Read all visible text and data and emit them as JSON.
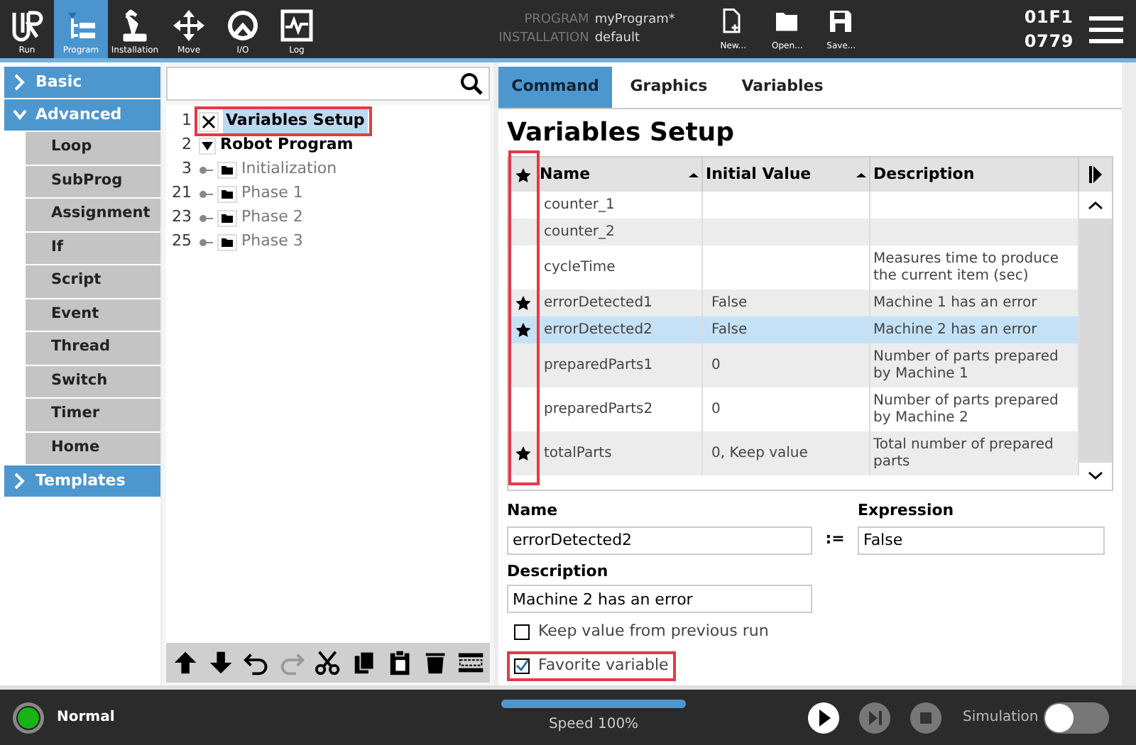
{
  "nav": [
    {
      "label": "Run",
      "selected": false
    },
    {
      "label": "Program",
      "selected": true
    },
    {
      "label": "Installation",
      "selected": false
    },
    {
      "label": "Move",
      "selected": false
    },
    {
      "label": "I/O",
      "selected": false
    },
    {
      "label": "Log",
      "selected": false
    }
  ],
  "program": {
    "program_label": "PROGRAM",
    "program_name": "myProgram*",
    "installation_label": "INSTALLATION",
    "installation_name": "default"
  },
  "file_buttons": [
    {
      "label": "New..."
    },
    {
      "label": "Open..."
    },
    {
      "label": "Save..."
    }
  ],
  "robot_id": [
    "01F1",
    "0779"
  ],
  "sidebar": [
    {
      "label": "Basic",
      "expanded": false
    },
    {
      "label": "Advanced",
      "expanded": true,
      "items": [
        "Loop",
        "SubProg",
        "Assignment",
        "If",
        "Script",
        "Event",
        "Thread",
        "Switch",
        "Timer",
        "Home"
      ]
    },
    {
      "label": "Templates",
      "expanded": false
    }
  ],
  "tree": [
    {
      "number": "1",
      "kind": "variables",
      "label": "Variables Setup",
      "selected": true,
      "highlighted": true
    },
    {
      "number": "2",
      "kind": "program",
      "label": "Robot Program",
      "selected": false,
      "expanded": true,
      "children": [
        {
          "number": "3",
          "kind": "folder",
          "label": "Initialization",
          "selected": false
        },
        {
          "number": "21",
          "kind": "folder",
          "label": "Phase 1",
          "selected": false
        },
        {
          "number": "23",
          "kind": "folder",
          "label": "Phase 2",
          "selected": false
        },
        {
          "number": "25",
          "kind": "folder",
          "label": "Phase 3",
          "selected": false
        }
      ]
    }
  ],
  "tabs": [
    {
      "label": "Command",
      "selected": true
    },
    {
      "label": "Graphics",
      "selected": false
    },
    {
      "label": "Variables",
      "selected": false
    }
  ],
  "heading": "Variables Setup",
  "table": {
    "favorite_column_highlighted": true,
    "columns": [
      "Name",
      "Initial Value",
      "Description"
    ],
    "rows": [
      {
        "favorite": false,
        "name": "counter_1",
        "initial_value": "",
        "description": "",
        "selected": false
      },
      {
        "favorite": false,
        "name": "counter_2",
        "initial_value": "",
        "description": "",
        "selected": false
      },
      {
        "favorite": false,
        "name": "cycleTime",
        "initial_value": "",
        "description": "Measures time to produce the current item (sec)",
        "selected": false
      },
      {
        "favorite": true,
        "name": "errorDetected1",
        "initial_value": "False",
        "description": "Machine 1 has an error",
        "selected": false
      },
      {
        "favorite": true,
        "name": "errorDetected2",
        "initial_value": "False",
        "description": "Machine 2 has an error",
        "selected": true
      },
      {
        "favorite": false,
        "name": "preparedParts1",
        "initial_value": "0",
        "description": "Number of parts prepared by Machine 1",
        "selected": false
      },
      {
        "favorite": false,
        "name": "preparedParts2",
        "initial_value": "0",
        "description": "Number of parts prepared by Machine 2",
        "selected": false
      },
      {
        "favorite": true,
        "name": "totalParts",
        "initial_value": "0, Keep value",
        "description": "Total number of prepared parts",
        "selected": false
      }
    ]
  },
  "form": {
    "name_label": "Name",
    "name_value": "errorDetected2",
    "assign": ":=",
    "expression_label": "Expression",
    "expression_value": "False",
    "description_label": "Description",
    "description_value": "Machine 2 has an error",
    "checkboxes": [
      {
        "label": "Keep value from previous run",
        "checked": false,
        "highlighted": false
      },
      {
        "label": "Favorite variable",
        "checked": true,
        "highlighted": true
      }
    ]
  },
  "status": "Normal",
  "speed": {
    "level": 1.0,
    "label": "Speed 100%"
  },
  "simulation": {
    "label": "Simulation",
    "on": false
  }
}
